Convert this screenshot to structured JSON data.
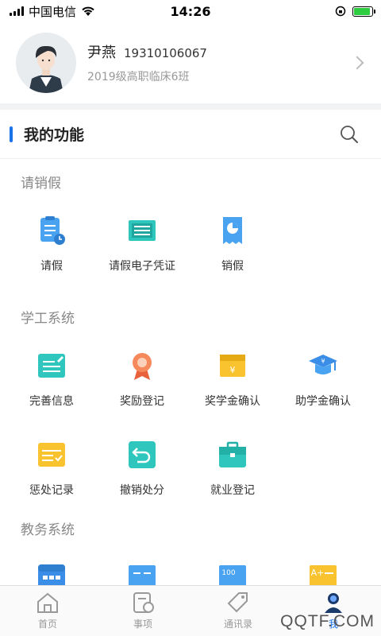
{
  "status_bar": {
    "carrier": "中国电信",
    "time": "14:26",
    "battery_color": "#2ecc40"
  },
  "profile": {
    "name": "尹燕",
    "phone": "19310106067",
    "class_name": "2019级高职临床6班"
  },
  "functions": {
    "title": "我的功能",
    "accent": "#1a73e8"
  },
  "sections": [
    {
      "title": "请销假",
      "items": [
        {
          "label": "请假",
          "icon": "leave-request-icon"
        },
        {
          "label": "请假电子凭证",
          "icon": "leave-certificate-icon"
        },
        {
          "label": "销假",
          "icon": "leave-cancel-icon"
        }
      ]
    },
    {
      "title": "学工系统",
      "items": [
        {
          "label": "完善信息",
          "icon": "edit-info-icon"
        },
        {
          "label": "奖励登记",
          "icon": "award-medal-icon"
        },
        {
          "label": "奖学金确认",
          "icon": "scholarship-icon"
        },
        {
          "label": "助学金确认",
          "icon": "grant-cap-icon"
        },
        {
          "label": "惩处记录",
          "icon": "penalty-record-icon"
        },
        {
          "label": "撤销处分",
          "icon": "revoke-icon"
        },
        {
          "label": "就业登记",
          "icon": "employment-briefcase-icon"
        }
      ]
    },
    {
      "title": "教务系统",
      "items": [
        {
          "label": "",
          "icon": "calendar-icon"
        },
        {
          "label": "",
          "icon": "card-icon"
        },
        {
          "label": "",
          "icon": "score-icon"
        },
        {
          "label": "",
          "icon": "grade-icon"
        }
      ]
    }
  ],
  "tabbar": {
    "tabs": [
      {
        "label": "首页",
        "icon": "home-icon"
      },
      {
        "label": "事项",
        "icon": "tasks-icon"
      },
      {
        "label": "通讯录",
        "icon": "contacts-tag-icon"
      },
      {
        "label": "我",
        "icon": "me-icon",
        "active": true
      }
    ],
    "watermark": "QQTF.COM"
  }
}
